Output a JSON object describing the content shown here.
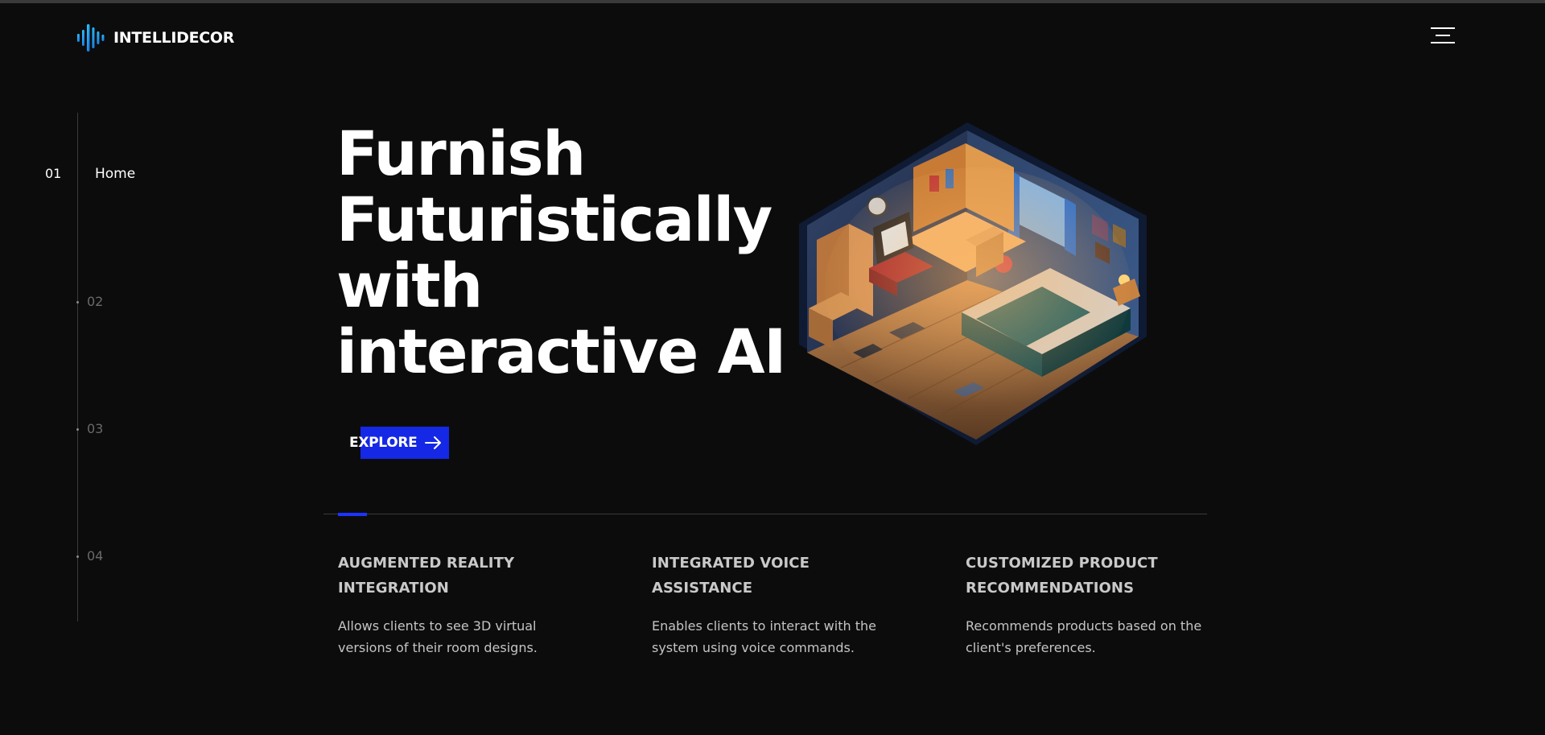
{
  "brand": {
    "name": "INTELLIDECOR"
  },
  "header": {
    "menu_icon": "hamburger-icon"
  },
  "sidenav": {
    "items": [
      {
        "num": "01",
        "label": "Home",
        "active": true
      },
      {
        "num": "02"
      },
      {
        "num": "03"
      },
      {
        "num": "04"
      }
    ]
  },
  "hero": {
    "title_lines": [
      "Furnish",
      "Futuristically",
      "with",
      "interactive AI"
    ],
    "cta_label": "EXPLORE",
    "cta_icon": "arrow-right-icon",
    "accent_color": "#1428e6"
  },
  "features": [
    {
      "title": "AUGMENTED REALITY INTEGRATION",
      "desc": "Allows clients to see 3D virtual versions of their room designs."
    },
    {
      "title": "INTEGRATED VOICE ASSISTANCE",
      "desc": "Enables clients to interact with the system using voice commands."
    },
    {
      "title": "CUSTOMIZED PRODUCT RECOMMENDATIONS",
      "desc": "Recommends products based on the client's preferences."
    }
  ]
}
